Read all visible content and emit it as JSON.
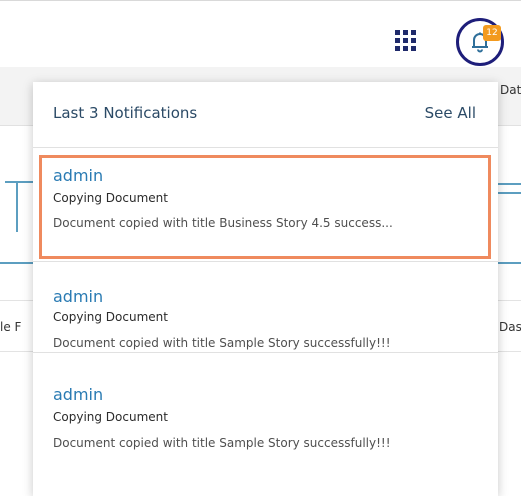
{
  "background": {
    "left_texts": [
      "le F"
    ],
    "right_texts": [
      "Dat",
      "Das"
    ]
  },
  "header": {
    "apps_icon": "grid-apps-icon",
    "bell_icon": "bell-icon",
    "notification_count": "12",
    "colors": {
      "bell_ring": "#1e1e7a",
      "badge": "#f39a1e"
    }
  },
  "dropdown": {
    "title": "Last 3 Notifications",
    "see_all": "See All",
    "items": [
      {
        "user": "admin",
        "action": "Copying Document",
        "description": "Document copied with title Business Story 4.5 success..."
      },
      {
        "user": "admin",
        "action": "Copying Document",
        "description": "Document copied with title Sample Story successfully!!!"
      },
      {
        "user": "admin",
        "action": "Copying Document",
        "description": "Document copied with title Sample Story successfully!!!"
      }
    ],
    "colors": {
      "highlight_border": "#ef8a5e",
      "user": "#2a7bb3",
      "title": "#2b4a66"
    }
  }
}
